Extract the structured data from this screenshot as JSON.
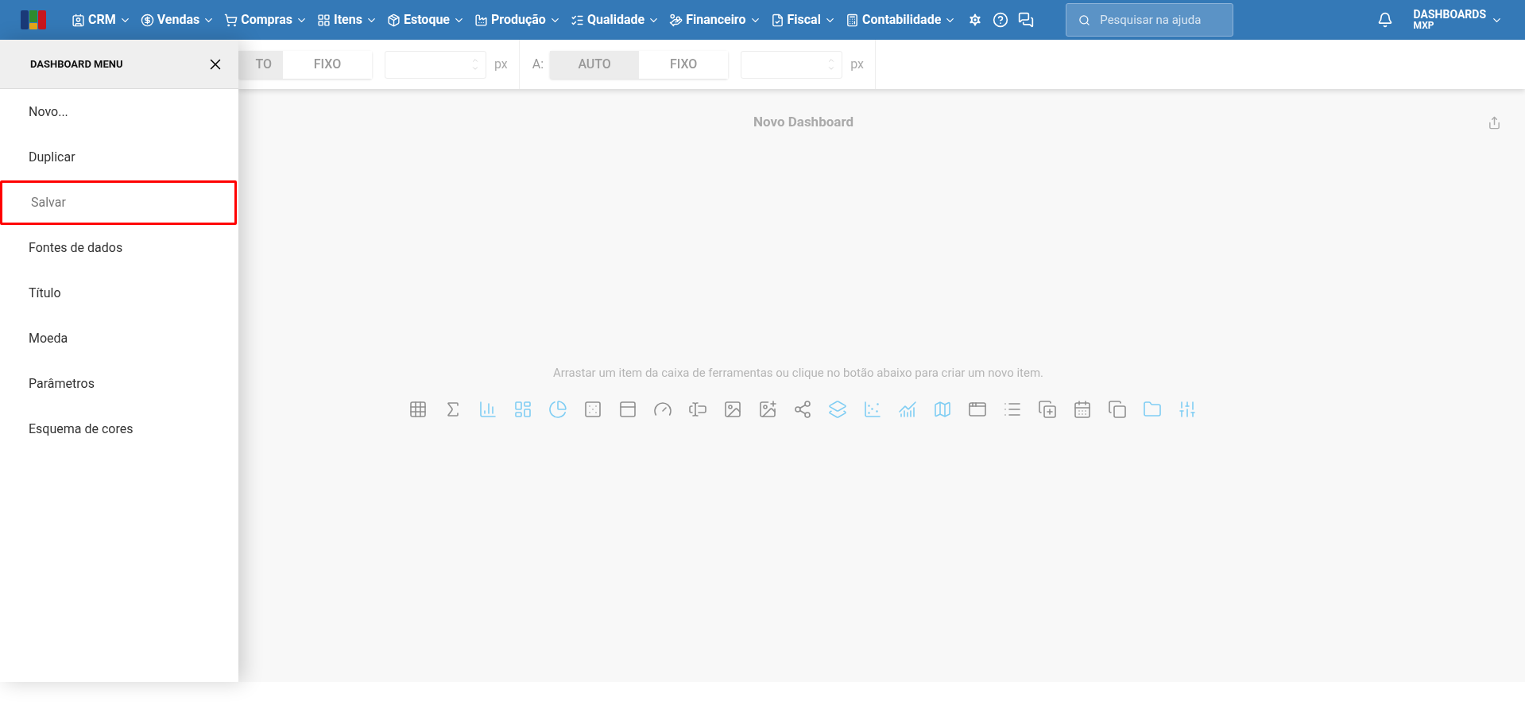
{
  "nav": {
    "items": [
      {
        "label": "CRM"
      },
      {
        "label": "Vendas"
      },
      {
        "label": "Compras"
      },
      {
        "label": "Itens"
      },
      {
        "label": "Estoque"
      },
      {
        "label": "Produção"
      },
      {
        "label": "Qualidade"
      },
      {
        "label": "Financeiro"
      },
      {
        "label": "Fiscal"
      },
      {
        "label": "Contabilidade"
      }
    ]
  },
  "search": {
    "placeholder": "Pesquisar na ajuda"
  },
  "user": {
    "name": "DASHBOARDS",
    "org": "MXP"
  },
  "sidebar": {
    "title": "DASHBOARD MENU",
    "items": [
      {
        "label": "Novo...",
        "selected": false
      },
      {
        "label": "Duplicar",
        "selected": false
      },
      {
        "label": "Salvar",
        "selected": true
      },
      {
        "label": "Fontes de dados",
        "selected": false
      },
      {
        "label": "Título",
        "selected": false
      },
      {
        "label": "Moeda",
        "selected": false
      },
      {
        "label": "Parâmetros",
        "selected": false
      },
      {
        "label": "Esquema de cores",
        "selected": false
      }
    ]
  },
  "toolbar": {
    "groups": [
      {
        "buttons": [
          {
            "label": "TO",
            "selected": true
          },
          {
            "label": "FIXO",
            "selected": false
          }
        ],
        "unit": "px"
      },
      {
        "label": "A:",
        "buttons": [
          {
            "label": "AUTO",
            "selected": true
          },
          {
            "label": "FIXO",
            "selected": false
          }
        ],
        "unit": "px"
      }
    ]
  },
  "canvas": {
    "title": "Novo Dashboard",
    "hint": "Arrastar um item da caixa de ferramentas ou clique no botão abaixo para criar um novo item."
  }
}
